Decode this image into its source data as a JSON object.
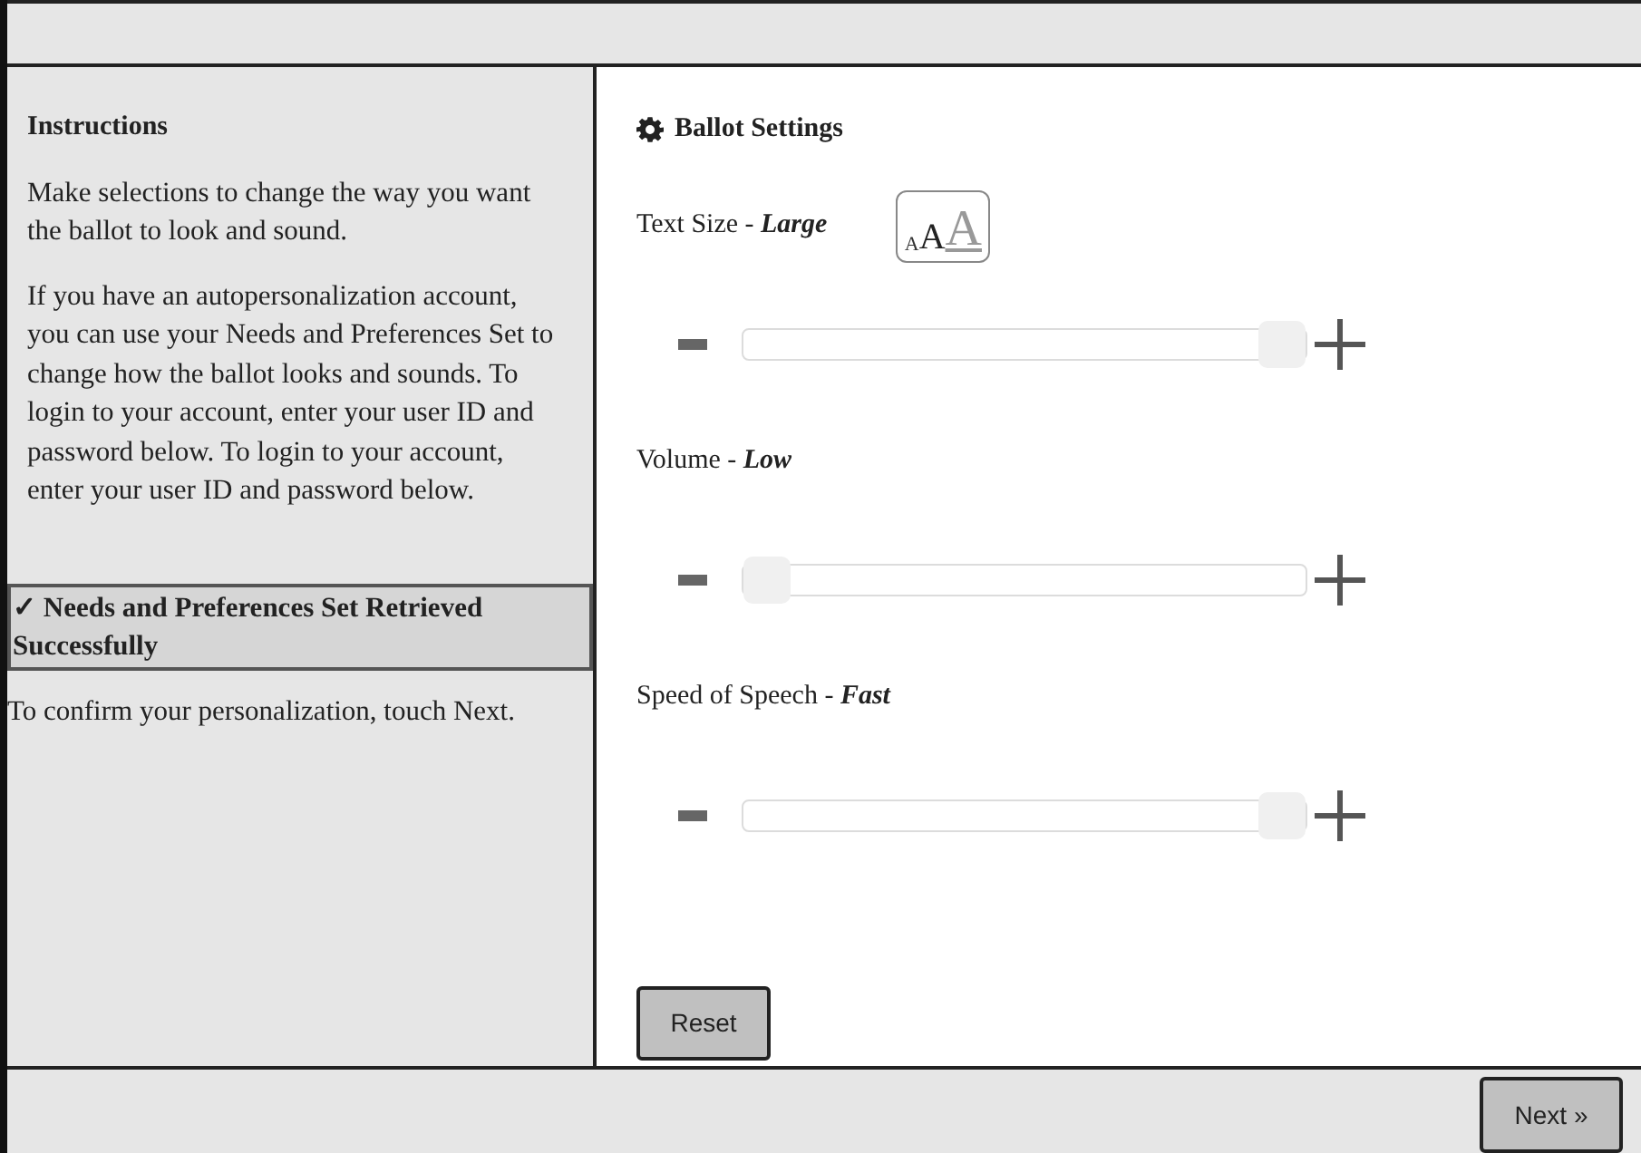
{
  "instructions": {
    "title": "Instructions",
    "paragraphs": [
      "Make selections to change the way you want the ballot to look and sound.",
      "If you have an autopersonalization account, you can use your Needs and Preferences Set to change how the ballot looks and sounds. To login to your account, enter your user ID and password below. To login to your account, enter your user ID and password below."
    ]
  },
  "status_message": "✓ Needs and Preferences Set Retrieved Successfully",
  "confirm_text": "To confirm your personalization, touch Next.",
  "settings": {
    "title": "Ballot Settings",
    "items": [
      {
        "label": "Text Size -",
        "value": "Large",
        "level": 1,
        "kind": "text-size",
        "letters": [
          "A",
          "A",
          "A"
        ]
      },
      {
        "label": "Volume -",
        "value": "Low",
        "level": 0,
        "kind": "plain"
      },
      {
        "label": "Speed of Speech -",
        "value": "Fast",
        "level": 1,
        "kind": "plain"
      }
    ],
    "reset_button": "Reset"
  },
  "next_button": "Next »"
}
